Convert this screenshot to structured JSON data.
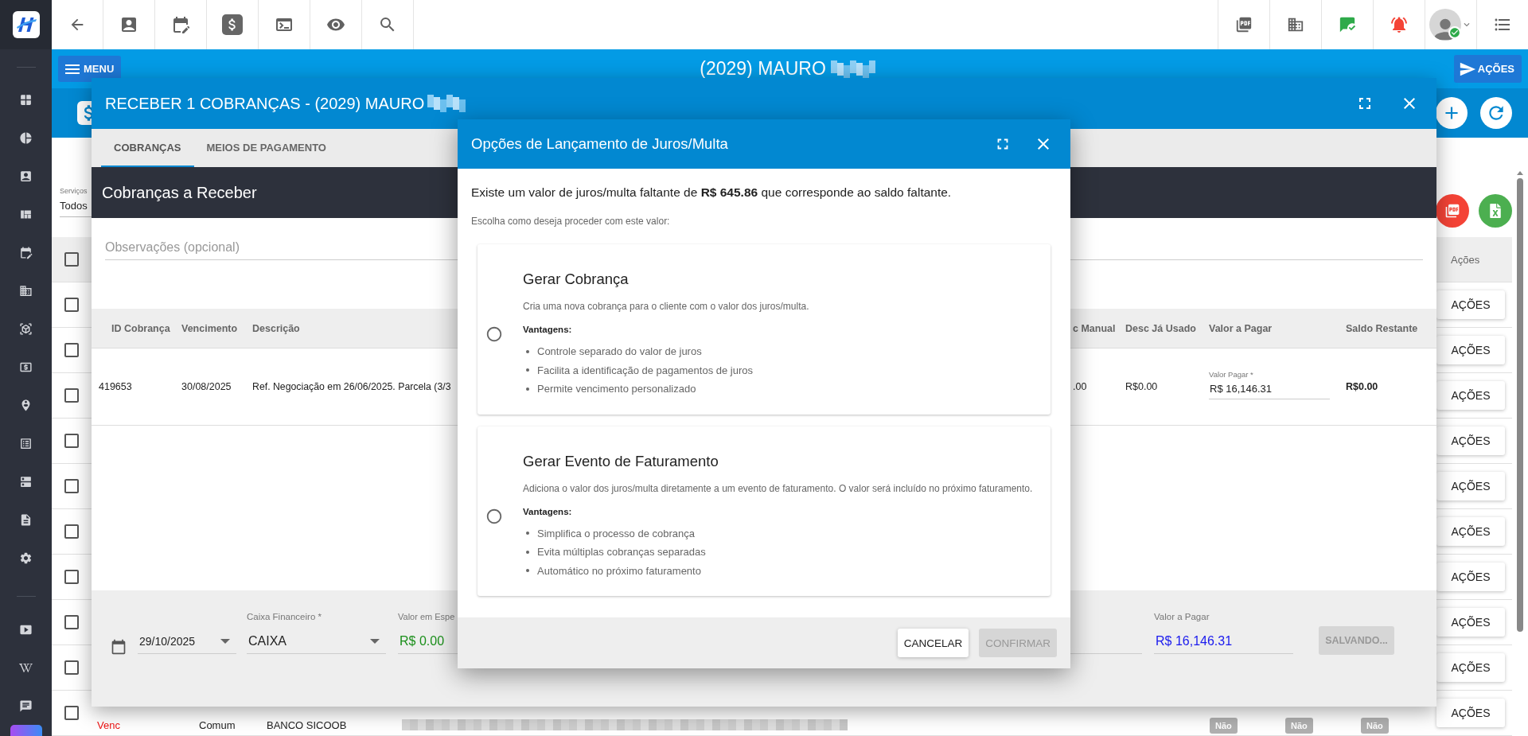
{
  "header": {
    "menu_button": "MENU",
    "title": "(2029) MAURO",
    "actions_button": "AÇÕES"
  },
  "page": {
    "filter": {
      "label": "Serviços",
      "value": "Todos"
    },
    "header_checked": false,
    "actions_column": "Ações",
    "rows": [
      {
        "checked": false,
        "action": "AÇÕES"
      },
      {
        "checked": false,
        "action": "AÇÕES"
      },
      {
        "checked": false,
        "action": "AÇÕES"
      },
      {
        "checked": false,
        "action": "AÇÕES"
      },
      {
        "checked": false,
        "action": "AÇÕES"
      },
      {
        "checked": false,
        "action": "AÇÕES"
      },
      {
        "checked": false,
        "action": "AÇÕES"
      },
      {
        "checked": false,
        "action": "AÇÕES"
      },
      {
        "checked": false,
        "action": "AÇÕES"
      },
      {
        "checked": false,
        "action": "AÇÕES",
        "status": "Venc",
        "type": "Comum",
        "bank": "BANCO SICOOB",
        "flags": [
          "Não",
          "Não",
          "Não"
        ]
      }
    ]
  },
  "dialog": {
    "title": "RECEBER 1 COBRANÇAS - (2029) MAURO",
    "tabs": [
      {
        "label": "COBRANÇAS",
        "selected": true
      },
      {
        "label": "MEIOS DE PAGAMENTO",
        "selected": false
      }
    ],
    "section_title": "Cobranças a Receber",
    "notes": {
      "placeholder": "Observações (opcional)"
    },
    "table": {
      "columns": [
        "ID Cobrança",
        "Vencimento",
        "Descrição",
        "c Manual",
        "Desc Já Usado",
        "Valor a Pagar",
        "Saldo Restante"
      ],
      "rows": [
        {
          "id": "419653",
          "due": "30/08/2025",
          "description": "Ref. Negociação em 26/06/2025. Parcela (3/3",
          "manual_discount": ".00",
          "used_discount": "R$0.00",
          "pay_label": "Valor Pagar *",
          "pay_value": "R$ 16,146.31",
          "balance": "R$0.00"
        }
      ]
    },
    "footer": {
      "date": "29/10/2025",
      "cash_label": "Caixa Financeiro *",
      "cash_value": "CAIXA",
      "amount_label": "Valor em Espe",
      "amount_value": "R$ 0.00",
      "total_label": "Valor a Pagar",
      "total_value": "R$ 16,146.31",
      "save_button": {
        "label": "SALVANDO...",
        "disabled": true
      }
    }
  },
  "modal": {
    "title": "Opções de Lançamento de Juros/Multa",
    "message": "Existe um valor de juros/multa faltante de **R$ 645.86** que corresponde ao saldo faltante.",
    "prompt": "Escolha como deseja proceder com este valor:",
    "options": [
      {
        "title": "Gerar Cobrança",
        "description": "Cria uma nova cobrança para o cliente com o valor dos juros/multa.",
        "advantages_label": "Vantagens:",
        "advantages": [
          "Controle separado do valor de juros",
          "Facilita a identificação de pagamentos de juros",
          "Permite vencimento personalizado"
        ],
        "selected": false
      },
      {
        "title": "Gerar Evento de Faturamento",
        "description": "Adiciona o valor dos juros/multa diretamente a um evento de faturamento. O valor será incluído no próximo faturamento.",
        "advantages_label": "Vantagens:",
        "advantages": [
          "Simplifica o processo de cobrança",
          "Evita múltiplas cobranças separadas",
          "Automático no próximo faturamento"
        ],
        "selected": false
      }
    ],
    "buttons": [
      {
        "label": "CANCELAR",
        "disabled": false
      },
      {
        "label": "CONFIRMAR",
        "disabled": true
      }
    ]
  }
}
